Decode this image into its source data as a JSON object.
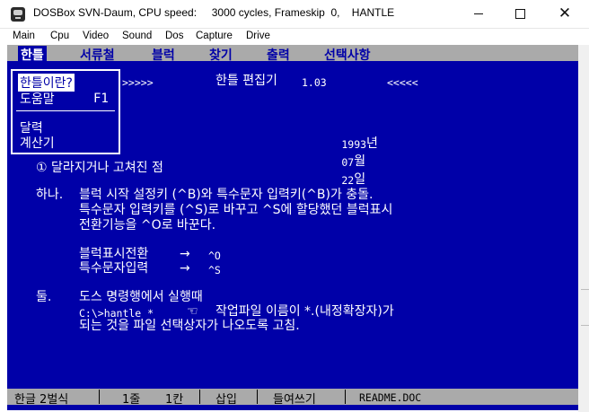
{
  "window": {
    "title": "DOSBox SVN-Daum, CPU speed:     3000 cycles, Frameskip  0,    HANTLE"
  },
  "dosbox_menu": [
    "Main",
    "Cpu",
    "Video",
    "Sound",
    "Dos",
    "Capture",
    "Drive"
  ],
  "app_menu": [
    "한틀",
    "서류철",
    "블럭",
    "찾기",
    "출력",
    "선택사항"
  ],
  "dropdown": {
    "item1": "한틀이란?",
    "item2": "도움말",
    "item2_key": "F1",
    "item3": "달력",
    "item4": "계산기"
  },
  "header": {
    "arrows_left": ">>>>>",
    "title": "한틀 편집기",
    "version": "1.03",
    "arrows_right": "<<<<<",
    "date_year": "1993",
    "date_year_unit": "년",
    "date_month": "07",
    "date_month_unit": "월",
    "date_day": "22",
    "date_day_unit": "일"
  },
  "content": {
    "section": "① 달라지거나 고쳐진 점",
    "item1_label": "하나.",
    "item1_line1": "블럭 시작 설정키 (^B)와 특수문자 입력키(^B)가 충돌.",
    "item1_line2": "특수문자 입력키를 (^S)로 바꾸고 ^S에 할당했던 블럭표시",
    "item1_line3": "전환기능을 ^O로 바꾼다.",
    "key1_name": "블럭표시전환",
    "key1_arrow": "→",
    "key1_key": "^O",
    "key2_name": "특수문자입력",
    "key2_arrow": "→",
    "key2_key": "^S",
    "item2_label": "둘.",
    "item2_line1": "도스 명령행에서 실행때",
    "item2_cmd": "C:\\>hantle *",
    "item2_hand": "☜",
    "item2_line2_rest": "작업파일 이름이 *.(내정확장자)가",
    "item2_line3": "되는 것을 파일 선택상자가 나오도록 고침."
  },
  "status": {
    "input_mode": "한글 2벌식",
    "line": "1줄",
    "col": "1칸",
    "insert": "삽입",
    "indent": "들여쓰기",
    "filename": "README.DOC"
  },
  "colors": {
    "dos_background": "#0000a8",
    "menubar": "#aaaaaa",
    "text": "#ffffff"
  }
}
